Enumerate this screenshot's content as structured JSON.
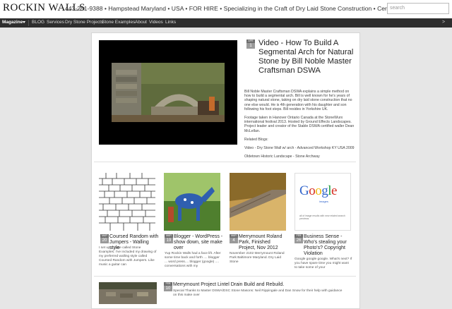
{
  "header": {
    "site_title": "ROCKIN WALLS",
    "tagline": "443-291-9388 • Hampstead Maryland • USA • FOR HIRE • Specializing in the Craft of Dry Laid Stone Construction • Certified",
    "search_placeholder": "search"
  },
  "nav": {
    "magazine": "Magazine",
    "items": [
      "BLOG",
      "Services",
      "Dry Stone Projects",
      "Stone Examples",
      "About",
      "Videos",
      "Links"
    ]
  },
  "featured": {
    "month": "APR",
    "day": "1",
    "title": "Video - How To Build A Segmental Arch for Natural Stone by Bill Noble Master Craftsman DSWA",
    "paragraphs": [
      "Bill Noble Master Craftsman DSWA explains a simple method on how to build a segmental arch. Bill is well known for he's years of shaping natural stone, taking on dry laid stone construction that no one else would. He is 4th generation with his daughter and son following his foot steps. Bill resides in Yorkshire UK.",
      "Footage taken in Hanover Ontario Canada at the StoneWurx international festival 2013. Hosted by Ground Effects Landscapes. Project leader and creator of the Stable DSWA certified waller Dean McLellan.",
      "Related Blogs:",
      "Video - Dry Stone Wall w/ arch - Advanced Workshop KY USA 2009",
      "Oldetown Historic Landscape - Stone Archway"
    ]
  },
  "cards": [
    {
      "month": "MAR",
      "day": "20",
      "title": "Coursed Random with Jumpers - Walling style",
      "excerpt": "I set up a page called Stone Examples. I've included my drawing of my preferred walling style called Coursed Random with Jumpers. Like music a guitar can"
    },
    {
      "month": "MAR",
      "day": "19",
      "title": "Blogger - WordPress - show down, site make over",
      "excerpt": "Yup Rockin Walls had a face lift. After some time back and forth .... blogger ... word press.... blogger (google) .... conversations with my"
    },
    {
      "month": "MAR",
      "day": "4",
      "title": "Merrymount Roland Park, Finished Project, Nov 2012",
      "excerpt": "November 2102 Merrymount Roland Park Baltimore Maryland. Dry Laid Stone"
    },
    {
      "month": "FEB",
      "day": "26",
      "title": "Business Sense - Who's stealing your Photo's? Copyright Violation",
      "excerpt": "Google google google. What's next? If you have spare time you might want to take some of your"
    }
  ],
  "google_card": {
    "logo_text": "Google",
    "sub_text": "images",
    "caption": "all of image results with new related search previews"
  },
  "bottom_post": {
    "month": "FEB",
    "day": "10",
    "title": "Merrymount Project Lintel Drain Build and Rebuild.",
    "excerpt": "Special Thanks to Master DSWA/DSC Stone Masons: Neil Rippingale and Dan Snow for their help with guidance on this make over"
  },
  "watermark": "ROCKIN WALLS",
  "colors": {
    "nav_bg": "#2e2e2e",
    "badge_month_bg": "#6e6e6e",
    "badge_day_bg": "#9a9a9a",
    "google_blue": "#3366cc",
    "google_red": "#d62d20",
    "google_yellow": "#f2b90c",
    "google_green": "#1b9e3e"
  }
}
